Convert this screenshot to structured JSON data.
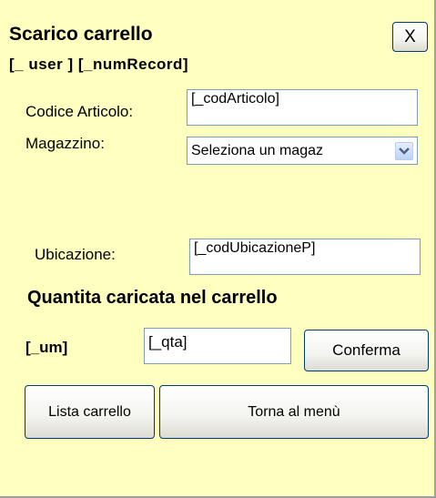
{
  "window": {
    "title": "Scarico carrello",
    "close_label": "X"
  },
  "header": {
    "user_record": "[_ user ] [_numRecord]"
  },
  "form": {
    "codice_label": "Codice Articolo:",
    "codice_value": "[_codArticolo]",
    "magazzino_label": "Magazzino:",
    "magazzino_value": "Seleziona un magaz",
    "ubicazione_label": "Ubicazione:",
    "ubicazione_value": "[_codUbicazioneP]"
  },
  "quantity": {
    "heading": "Quantita caricata nel carrello",
    "um_label": "[_um]",
    "qta_value": "[_qta]",
    "confirm_label": "Conferma"
  },
  "actions": {
    "list_label": "Lista carrello",
    "back_label": "Torna al menù"
  },
  "colors": {
    "background": "#ffffc0",
    "field_border": "#7f9db9",
    "button_border": "#003c74"
  }
}
